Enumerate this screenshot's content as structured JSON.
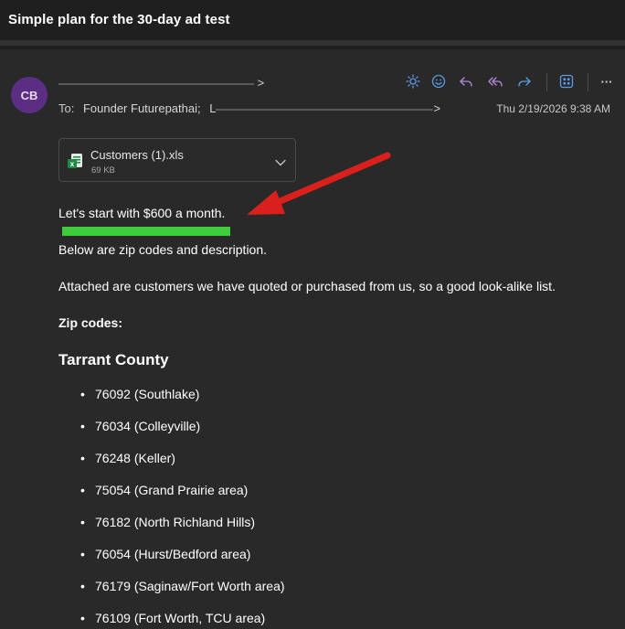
{
  "window": {
    "subject": "Simple plan for the 30-day ad test"
  },
  "sender": {
    "initials": "CB",
    "from_suffix": ">",
    "to_label": "To:",
    "to_first": "Founder Futurepathai;",
    "to_second_prefix": "L",
    "to_suffix": ">",
    "date": "Thu 2/19/2026 9:38 AM"
  },
  "toolbar": {
    "icons": [
      "sun-icon",
      "emoji-icon",
      "reply-icon",
      "reply-all-icon",
      "forward-icon",
      "apps-icon",
      "more-icon"
    ],
    "more_label": "···"
  },
  "attachment": {
    "name": "Customers (1).xls",
    "size": "69 KB",
    "icon": "excel-icon"
  },
  "body": {
    "line1": "Let's start with $600 a month.",
    "line2": "Below are zip codes and description.",
    "line3": "Attached are customers we have quoted or purchased from us, so a good look-alike list.",
    "zip_heading": "Zip codes:",
    "county": "Tarrant County",
    "zips": [
      "76092 (Southlake)",
      "76034 (Colleyville)",
      "76248 (Keller)",
      "75054 (Grand Prairie area)",
      "76182 (North Richland Hills)",
      "76054 (Hurst/Bedford area)",
      "76179 (Saginaw/Fort Worth area)",
      "76109 (Fort Worth, TCU area)"
    ]
  },
  "colors": {
    "highlight": "#3fcc3a",
    "arrow": "#d9201c",
    "avatar": "#5c2e83",
    "accent_toolbar": "#5b9be8",
    "accent_reply": "#b48ad8"
  }
}
